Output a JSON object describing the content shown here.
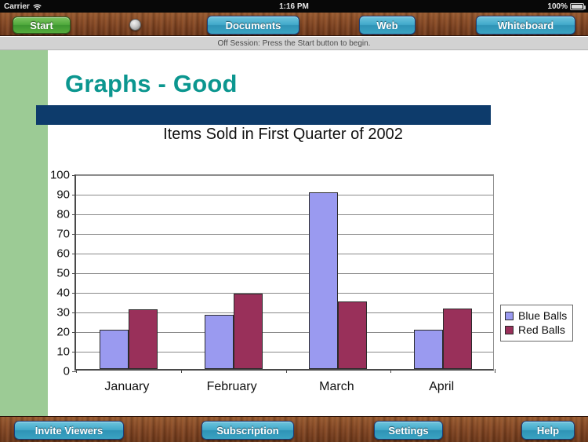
{
  "statusbar": {
    "carrier": "Carrier",
    "wifi_icon": "wifi-icon",
    "time": "1:16 PM",
    "battery_percent": "100%",
    "battery_icon": "battery-icon"
  },
  "toolbar_top": {
    "start_label": "Start",
    "indicator_icon": "status-led-icon",
    "documents_label": "Documents",
    "web_label": "Web",
    "whiteboard_label": "Whiteboard"
  },
  "session": {
    "status_text": "Off Session: Press the Start button to begin."
  },
  "slide": {
    "title": "Graphs - Good",
    "title_color": "#0b968f",
    "accent_bar_color": "#0d3b6b",
    "sidebar_color": "#9ccb95"
  },
  "toolbar_bottom": {
    "invite_viewers_label": "Invite Viewers",
    "subscription_label": "Subscription",
    "settings_label": "Settings",
    "help_label": "Help"
  },
  "chart_data": {
    "type": "bar",
    "title": "Items Sold in First Quarter of 2002",
    "xlabel": "",
    "ylabel": "",
    "categories": [
      "January",
      "February",
      "March",
      "April"
    ],
    "series": [
      {
        "name": "Blue Balls",
        "color": "#9a9af0",
        "values": [
          20,
          27.5,
          90,
          20
        ]
      },
      {
        "name": "Red Balls",
        "color": "#99305a",
        "values": [
          30.5,
          38.5,
          34.5,
          31
        ]
      }
    ],
    "ylim": [
      0,
      100
    ],
    "yticks": [
      100,
      90,
      80,
      70,
      60,
      50,
      40,
      30,
      20,
      10,
      0
    ],
    "grid": true,
    "legend_position": "right"
  }
}
